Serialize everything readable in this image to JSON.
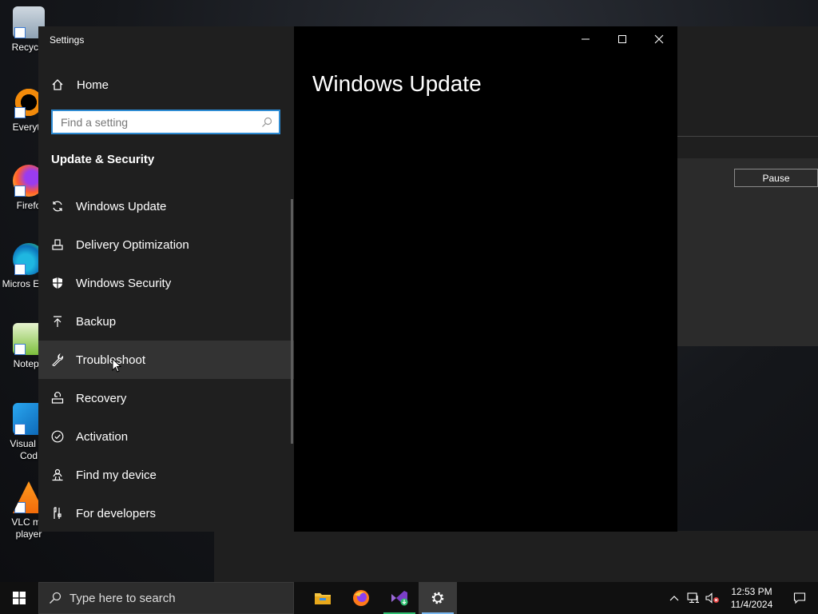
{
  "desktop": {
    "icons": [
      {
        "label": "Recycle",
        "icon": "recycle-bin-icon"
      },
      {
        "label": "Everyth",
        "icon": "everything-icon"
      },
      {
        "label": "Firefo",
        "icon": "firefox-icon"
      },
      {
        "label": "Micros Edge",
        "icon": "edge-icon"
      },
      {
        "label": "Notepa",
        "icon": "notepad-icon"
      },
      {
        "label": "Visual St Cod",
        "icon": "vscode-icon"
      },
      {
        "label": "VLC me player",
        "icon": "vlc-icon"
      }
    ]
  },
  "background_window": {
    "pause_label": "Pause"
  },
  "settings": {
    "app_title": "Settings",
    "home_label": "Home",
    "search_placeholder": "Find a setting",
    "section_title": "Update & Security",
    "nav_items": [
      {
        "label": "Windows Update",
        "icon": "refresh-icon"
      },
      {
        "label": "Delivery Optimization",
        "icon": "delivery-optimization-icon"
      },
      {
        "label": "Windows Security",
        "icon": "shield-icon"
      },
      {
        "label": "Backup",
        "icon": "backup-arrow-icon"
      },
      {
        "label": "Troubleshoot",
        "icon": "wrench-icon"
      },
      {
        "label": "Recovery",
        "icon": "recovery-icon"
      },
      {
        "label": "Activation",
        "icon": "check-circle-icon"
      },
      {
        "label": "Find my device",
        "icon": "person-location-icon"
      },
      {
        "label": "For developers",
        "icon": "developer-tools-icon"
      }
    ],
    "hovered_item": "Troubleshoot",
    "page_title": "Windows Update"
  },
  "taskbar": {
    "search_placeholder": "Type here to search",
    "apps": [
      "file-explorer",
      "firefox",
      "visual-studio-installer",
      "settings"
    ],
    "active_app": "settings",
    "time": "12:53 PM",
    "date": "11/4/2024"
  },
  "colors": {
    "accent": "#2d8bd3",
    "sidebar_bg": "#1f1f1f",
    "content_bg": "#000000",
    "taskbar_bg": "#101010"
  }
}
